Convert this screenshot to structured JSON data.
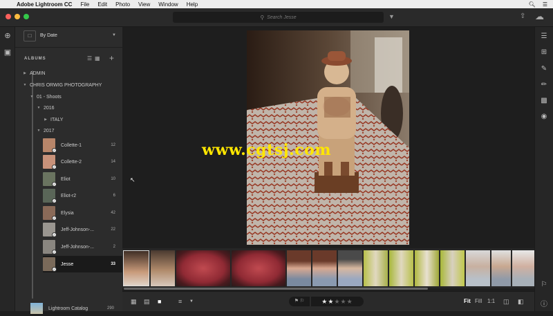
{
  "menubar": {
    "app_name": "Adobe Lightroom CC",
    "items": [
      "File",
      "Edit",
      "Photo",
      "View",
      "Window",
      "Help"
    ]
  },
  "titlebar": {
    "search_placeholder": "Search Jesse"
  },
  "panel": {
    "sort_label": "By Date",
    "albums_heading": "ALBUMS",
    "tree": [
      {
        "label": "ADMIN",
        "level": 0,
        "expanded": false
      },
      {
        "label": "CHRIS ORWIG PHOTOGRAPHY",
        "level": 0,
        "expanded": true
      },
      {
        "label": "01 - Shoots",
        "level": 1,
        "expanded": true
      },
      {
        "label": "2016",
        "level": 2,
        "expanded": true
      },
      {
        "label": "ITALY",
        "level": 3,
        "expanded": false
      },
      {
        "label": "2017",
        "level": 2,
        "expanded": true
      }
    ],
    "albums": [
      {
        "label": "Collette-1",
        "count": "12",
        "color": "#b8866a"
      },
      {
        "label": "Collette-2",
        "count": "14",
        "color": "#c8927a"
      },
      {
        "label": "Eliot",
        "count": "10",
        "color": "#6a7460"
      },
      {
        "label": "Eliot-r2",
        "count": "6",
        "color": "#5a6658"
      },
      {
        "label": "Elysia",
        "count": "42",
        "color": "#8a6a58"
      },
      {
        "label": "Jeff-Johnson-...",
        "count": "22",
        "color": "#9a9690"
      },
      {
        "label": "Jeff-Johnson-...",
        "count": "2",
        "color": "#8a8680"
      },
      {
        "label": "Jesse",
        "count": "33",
        "color": "#7a6a5a",
        "selected": true
      }
    ],
    "catalog": {
      "label": "Lightroom Catalog",
      "count": "290"
    }
  },
  "watermark": "www.cgtsj.com",
  "filmstrip": [
    {
      "kind": "figurine",
      "selected": true
    },
    {
      "kind": "figurine",
      "selected": false
    },
    {
      "kind": "plate",
      "selected": false
    },
    {
      "kind": "plate",
      "selected": false
    },
    {
      "kind": "portrait-hat",
      "selected": false
    },
    {
      "kind": "portrait-hat",
      "selected": false
    },
    {
      "kind": "portrait-hat",
      "selected": false
    },
    {
      "kind": "portrait-green",
      "selected": false
    },
    {
      "kind": "portrait-green",
      "selected": false
    },
    {
      "kind": "portrait-green",
      "selected": false
    },
    {
      "kind": "portrait-green",
      "selected": false
    },
    {
      "kind": "portrait-gray",
      "selected": false
    },
    {
      "kind": "portrait-gray",
      "selected": false
    },
    {
      "kind": "portrait-gray",
      "selected": false
    }
  ],
  "bottombar": {
    "rating": 2,
    "rating_max": 5,
    "zoom_fit": "Fit",
    "zoom_fill": "Fill",
    "zoom_11": "1:1"
  },
  "colors": {
    "accent": "#ffe600",
    "bg": "#1e1e1e",
    "panel": "#2c2c2c"
  }
}
